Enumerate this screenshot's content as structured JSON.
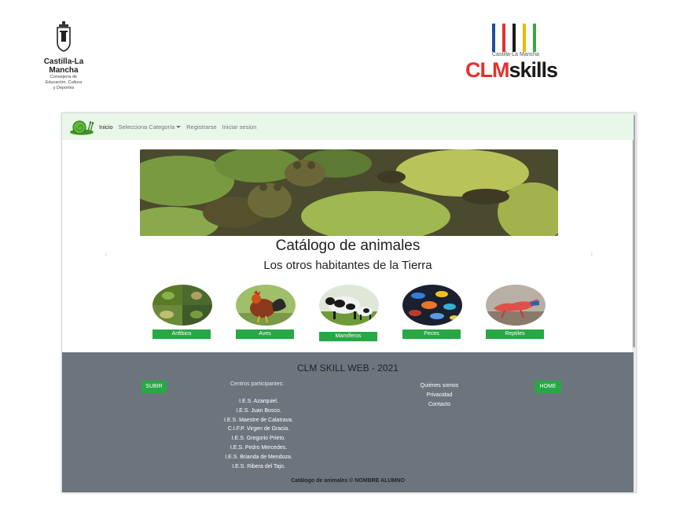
{
  "logos": {
    "clm": {
      "name": "Castilla-La Mancha",
      "line1": "Consejería de",
      "line2": "Educación, Cultura",
      "line3": "y Deportes"
    },
    "skills": {
      "tag": "Castilla-La Mancha",
      "brand_part1": "CLM",
      "brand_part2": "skills",
      "bar_colors": [
        "#1f4e9c",
        "#e3322d",
        "#1a1a1a",
        "#f2b600",
        "#3aa640"
      ]
    }
  },
  "navbar": {
    "logo_icon": "snail-icon",
    "items": [
      {
        "label": "Inicio",
        "active": true
      },
      {
        "label": "Selecciona Categoría",
        "dropdown": true
      },
      {
        "label": "Registrarse"
      },
      {
        "label": "Iniciar sesion"
      }
    ]
  },
  "hero": {
    "banner_image": "frogs-on-lily-pads",
    "prev_icon": "chevron-left-icon",
    "next_icon": "chevron-right-icon",
    "title": "Catálogo de animales",
    "subtitle": "Los otros habitantes de la Tierra"
  },
  "categories": [
    {
      "label": "Anfibios",
      "image": "frog-collage"
    },
    {
      "label": "Aves",
      "image": "rooster"
    },
    {
      "label": "Mamíferos",
      "image": "cow-and-calf"
    },
    {
      "label": "Peces",
      "image": "cichlid-fish"
    },
    {
      "label": "Reptiles",
      "image": "red-lizard"
    }
  ],
  "footer": {
    "title": "CLM SKILL WEB - 2021",
    "subir_label": "SUBIR",
    "home_label": "HOME",
    "centros_heading": "Centros participantes:",
    "centros": [
      "I.E.S. Azarquiel.",
      "I.E.S. Juan Bosco.",
      "I.E.S. Maestre de Calatrava.",
      "C.I.F.P. Virgen de Gracia.",
      "I.E.S. Gregorio Prieto.",
      "I.E.S. Pedro Mercedes.",
      "I.E.S. Brianda de Mendoza.",
      "I.E.S. Ribera del Tajo."
    ],
    "links": [
      "Quiénes somos",
      "Privacidad",
      "Contacto"
    ],
    "copyright": "Catálogo de animales © NOMBRE ALUMNO"
  },
  "colors": {
    "navbar_bg": "#e8f7e8",
    "footer_bg": "#6c757d",
    "button_green": "#28a745"
  }
}
